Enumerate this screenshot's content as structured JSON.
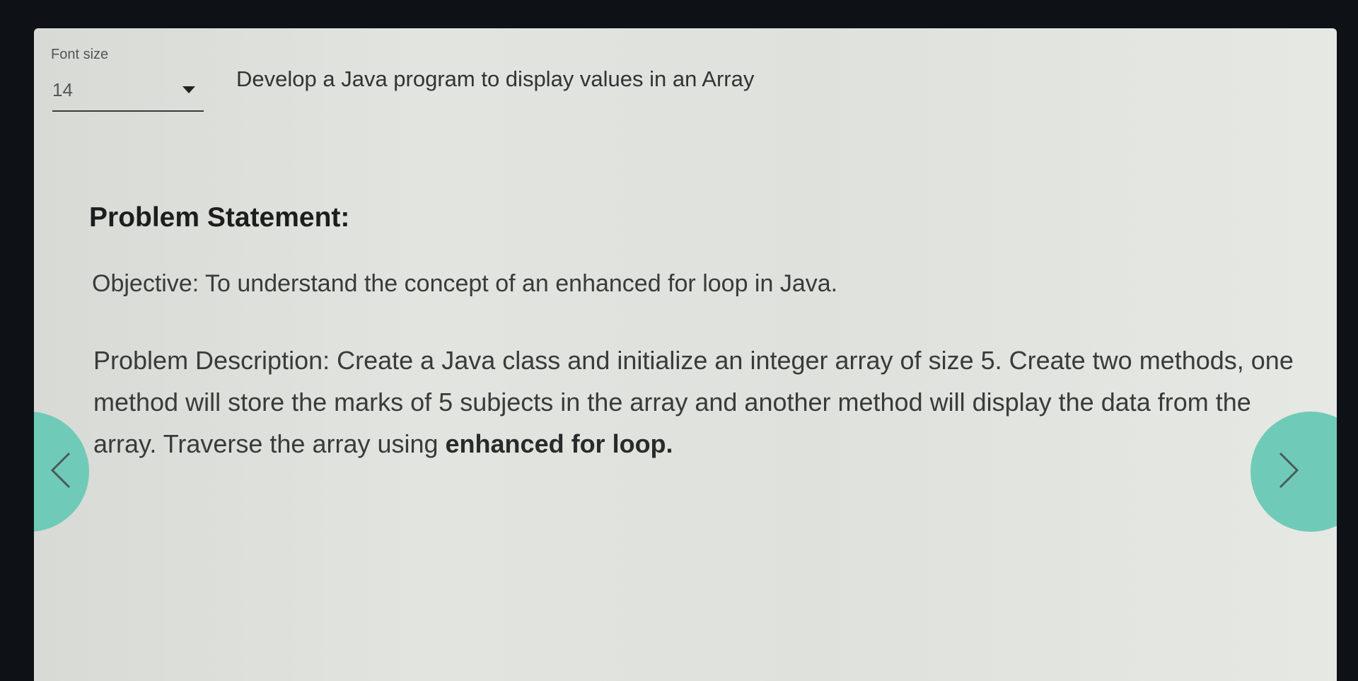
{
  "toolbar": {
    "font_size_label": "Font size",
    "font_size_value": "14"
  },
  "question": {
    "title": "Develop a Java program to display values in an Array"
  },
  "content": {
    "heading": "Problem Statement:",
    "objective_label": "Objective:",
    "objective_text": " To understand the concept of an enhanced for loop in Java.",
    "description_label": "Problem Description:",
    "description_text": " Create a Java class and initialize an integer array of size 5. Create two methods, one method will store the marks of 5 subjects in the array and another method will display the data from the array. Traverse the array using ",
    "description_emphasis": "enhanced for loop."
  },
  "navigation": {
    "prev_icon": "chevron-left-icon",
    "next_icon": "chevron-right-icon",
    "accent_color": "#6fcbb7"
  }
}
